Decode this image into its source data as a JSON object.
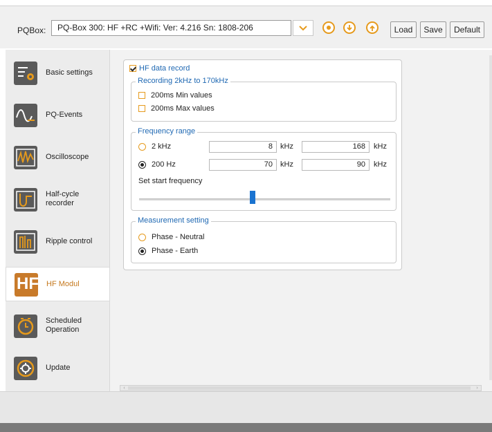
{
  "toolbar": {
    "pqbox_label": "PQBox:",
    "device_value": "PQ-Box 300: HF +RC +Wifi: Ver: 4.216 Sn: 1808-206",
    "load_label": "Load",
    "save_label": "Save",
    "default_label": "Default",
    "icons": [
      "chevron-down-icon",
      "record-icon",
      "download-icon",
      "upload-icon"
    ]
  },
  "sidebar": {
    "items": [
      {
        "label": "Basic settings",
        "icon": "settings-sliders-icon"
      },
      {
        "label": "PQ-Events",
        "icon": "pq-events-icon"
      },
      {
        "label": "Oscilloscope",
        "icon": "oscilloscope-icon"
      },
      {
        "label": "Half-cycle recorder",
        "line1": "Half-cycle",
        "line2": "recorder",
        "icon": "half-cycle-icon"
      },
      {
        "label": "Ripple control",
        "icon": "ripple-control-icon"
      },
      {
        "label": "HF Modul",
        "icon": "hf-icon",
        "icon_text": "HF",
        "active": true
      },
      {
        "label": "Scheduled Operation",
        "line1": "Scheduled",
        "line2": "Operation",
        "icon": "clock-icon"
      },
      {
        "label": "Update",
        "icon": "update-gear-icon"
      }
    ]
  },
  "hf": {
    "record_label": "HF data record",
    "record_checked": true,
    "recording": {
      "title": "Recording 2kHz to 170kHz",
      "min_label": "200ms Min values",
      "max_label": "200ms Max values",
      "min_checked": false,
      "max_checked": false
    },
    "frequency": {
      "title": "Frequency range",
      "opt_2khz": "2 kHz",
      "opt_200hz": "200 Hz",
      "selected": "200 Hz",
      "row1_from": "8",
      "row1_to": "168",
      "row2_from": "70",
      "row2_to": "90",
      "unit": "kHz",
      "start_label": "Set start frequency",
      "slider_value": 0.45
    },
    "measurement": {
      "title": "Measurement setting",
      "opt_pn": "Phase - Neutral",
      "opt_pe": "Phase - Earth",
      "selected": "Phase - Earth"
    }
  },
  "colors": {
    "accent": "#e69a1c",
    "link_blue": "#2069b3",
    "slider": "#1a73d0",
    "active_label": "#c5781d"
  }
}
